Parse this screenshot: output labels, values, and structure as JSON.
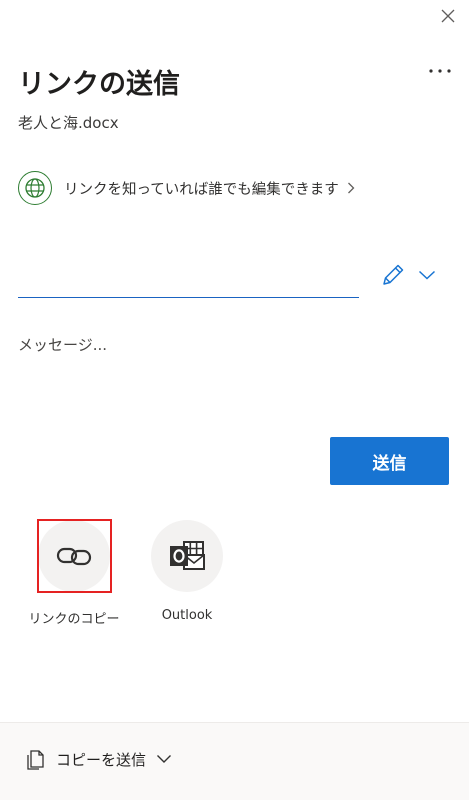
{
  "dialog": {
    "title": "リンクの送信",
    "filename": "老人と海.docx"
  },
  "permissions": {
    "label": "リンクを知っていれば誰でも編集できます"
  },
  "recipient": {
    "value": "",
    "placeholder": ""
  },
  "message": {
    "placeholder": "メッセージ..."
  },
  "send_button": {
    "label": "送信"
  },
  "share_options": [
    {
      "label": "リンクのコピー",
      "icon": "link-icon"
    },
    {
      "label": "Outlook",
      "icon": "outlook-icon"
    }
  ],
  "footer": {
    "copy_send_label": "コピーを送信"
  },
  "colors": {
    "accent": "#1874d2",
    "underline": "#1a63c2",
    "globe": "#2e7d32",
    "highlight": "#e52222"
  }
}
